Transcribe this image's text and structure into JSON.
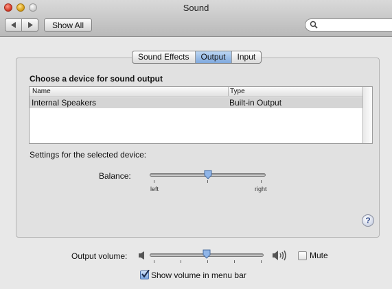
{
  "window": {
    "title": "Sound"
  },
  "toolbar": {
    "back_icon": "back-arrow-icon",
    "forward_icon": "forward-arrow-icon",
    "show_all_label": "Show All",
    "search_placeholder": ""
  },
  "tabs": [
    {
      "label": "Sound Effects",
      "selected": false
    },
    {
      "label": "Output",
      "selected": true
    },
    {
      "label": "Input",
      "selected": false
    }
  ],
  "output": {
    "section_title": "Choose a device for sound output",
    "table": {
      "columns": [
        "Name",
        "Type"
      ],
      "rows": [
        {
          "name": "Internal Speakers",
          "type": "Built-in Output",
          "selected": true
        }
      ]
    },
    "settings_label": "Settings for the selected device:",
    "balance": {
      "label": "Balance:",
      "left_label": "left",
      "right_label": "right",
      "value": 0.5
    }
  },
  "volume": {
    "label": "Output volume:",
    "value": 0.5,
    "mute_label": "Mute",
    "mute_checked": false,
    "show_in_menubar_label": "Show volume in menu bar",
    "show_in_menubar_checked": true
  },
  "colors": {
    "accent": "#7fa9de",
    "selected_row": "#d5d5d5"
  }
}
